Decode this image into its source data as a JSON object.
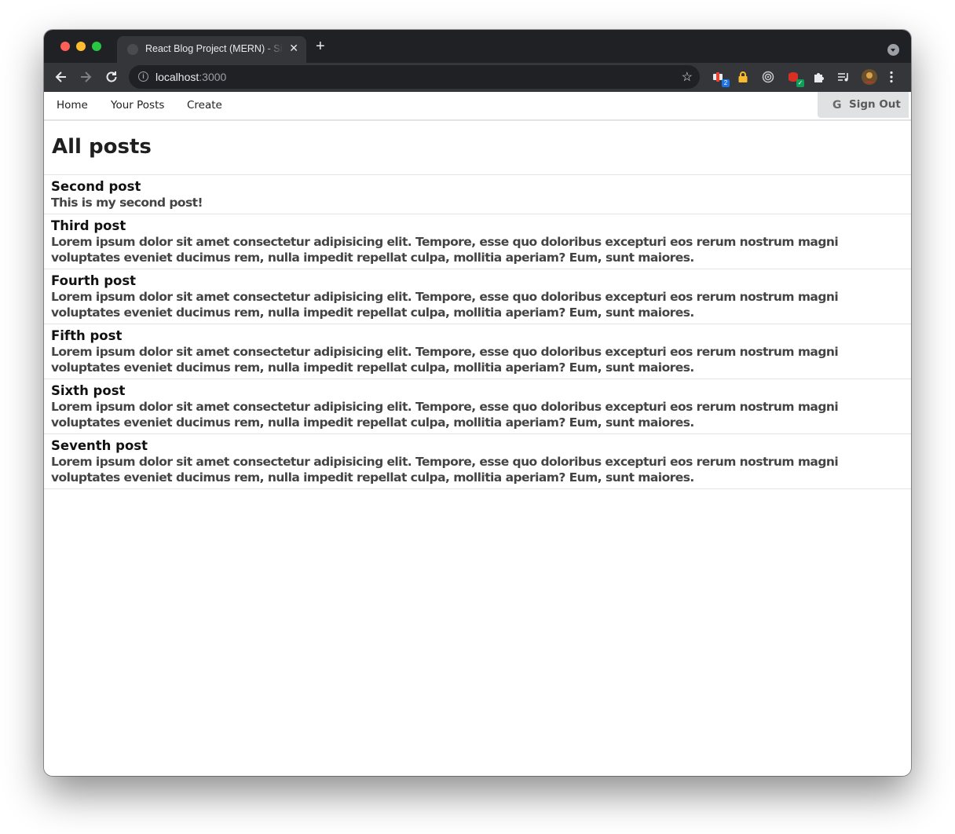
{
  "browser": {
    "tab_title": "React Blog Project (MERN) - Sign In",
    "url_host": "localhost",
    "url_port": ":3000"
  },
  "nav": {
    "links": [
      "Home",
      "Your Posts",
      "Create"
    ],
    "signout_label": "Sign Out",
    "signout_icon": "G"
  },
  "page": {
    "title": "All posts"
  },
  "posts": [
    {
      "title": "Second post",
      "body": "This is my second post!"
    },
    {
      "title": "Third post",
      "body": "Lorem ipsum dolor sit amet consectetur adipisicing elit. Tempore, esse quo doloribus excepturi eos rerum nostrum magni voluptates eveniet ducimus rem, nulla impedit repellat culpa, mollitia aperiam? Eum, sunt maiores."
    },
    {
      "title": "Fourth post",
      "body": "Lorem ipsum dolor sit amet consectetur adipisicing elit. Tempore, esse quo doloribus excepturi eos rerum nostrum magni voluptates eveniet ducimus rem, nulla impedit repellat culpa, mollitia aperiam? Eum, sunt maiores."
    },
    {
      "title": "Fifth post",
      "body": "Lorem ipsum dolor sit amet consectetur adipisicing elit. Tempore, esse quo doloribus excepturi eos rerum nostrum magni voluptates eveniet ducimus rem, nulla impedit repellat culpa, mollitia aperiam? Eum, sunt maiores."
    },
    {
      "title": "Sixth post",
      "body": "Lorem ipsum dolor sit amet consectetur adipisicing elit. Tempore, esse quo doloribus excepturi eos rerum nostrum magni voluptates eveniet ducimus rem, nulla impedit repellat culpa, mollitia aperiam? Eum, sunt maiores."
    },
    {
      "title": "Seventh post",
      "body": "Lorem ipsum dolor sit amet consectetur adipisicing elit. Tempore, esse quo doloribus excepturi eos rerum nostrum magni voluptates eveniet ducimus rem, nulla impedit repellat culpa, mollitia aperiam? Eum, sunt maiores."
    }
  ],
  "extensions": {
    "badge_1": "2",
    "badge_2": "✓"
  },
  "colors": {
    "chrome_dark": "#202124",
    "chrome_toolbar": "#35363a",
    "signout_bg": "#e0e1e2",
    "divider": "#e3e3e3"
  }
}
